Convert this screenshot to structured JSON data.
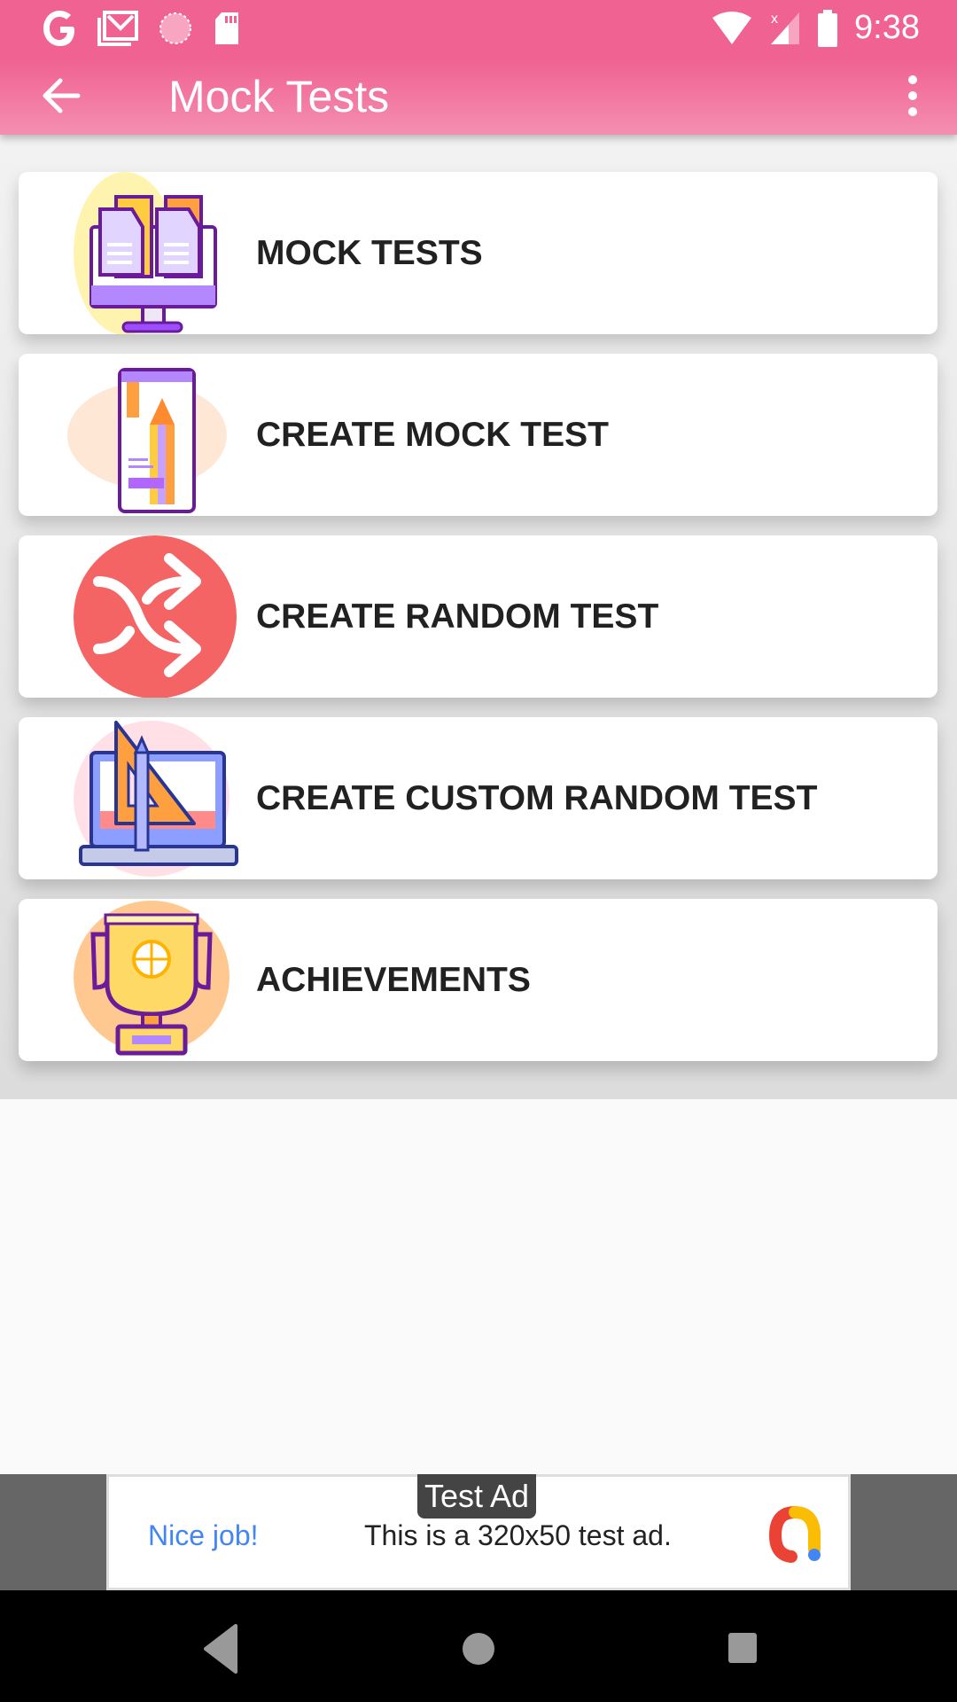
{
  "status_bar": {
    "time": "9:38",
    "left_icons": [
      "google-icon",
      "gmail-icon",
      "sync-icon",
      "sd-card-icon"
    ],
    "right_icons": [
      "wifi-icon",
      "signal-icon",
      "battery-icon"
    ]
  },
  "app_bar": {
    "title": "Mock Tests",
    "back_icon": "arrow-left-icon",
    "menu_icon": "more-vertical-icon",
    "color": "#f06292"
  },
  "menu": {
    "items": [
      {
        "label": "MOCK TESTS",
        "icon": "monitor-documents-icon"
      },
      {
        "label": "CREATE MOCK TEST",
        "icon": "phone-pencil-icon"
      },
      {
        "label": "CREATE RANDOM TEST",
        "icon": "shuffle-icon"
      },
      {
        "label": "CREATE CUSTOM RANDOM TEST",
        "icon": "laptop-ruler-icon"
      },
      {
        "label": "ACHIEVEMENTS",
        "icon": "trophy-icon"
      }
    ]
  },
  "ad": {
    "badge": "Test Ad",
    "headline": "Nice job!",
    "body": "This is a 320x50 test ad.",
    "logo": "admob-logo-icon"
  },
  "nav_bar": {
    "buttons": [
      "back-triangle-icon",
      "home-circle-icon",
      "recents-square-icon"
    ]
  }
}
